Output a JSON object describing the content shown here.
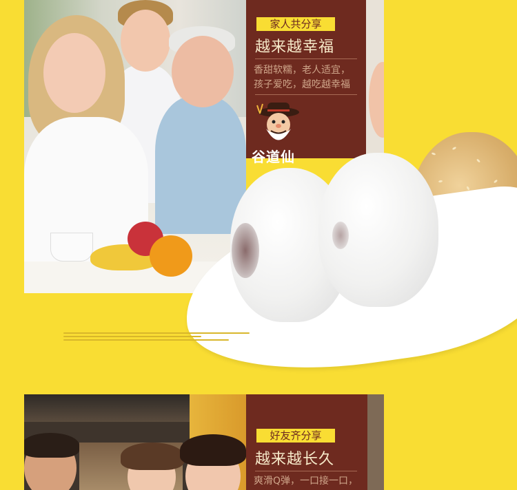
{
  "section1": {
    "tag": "家人共分享",
    "headline": "越来越幸福",
    "body_line1": "香甜软糯，老人适宜，",
    "body_line2": "孩子爱吃，越吃越幸福"
  },
  "brand": {
    "name": "谷道仙",
    "mascot_icon": "old-man-cowboy-hat-icon"
  },
  "section2": {
    "tag": "好友齐分享",
    "headline": "越来越长久",
    "body_line1": "爽滑Q弹，一口接一口，"
  },
  "colors": {
    "background": "#f9dd33",
    "card": "#6e2a1f",
    "tag_bg": "#f9dd33",
    "headline": "#f6e9c9",
    "body_text": "#cfa58a"
  }
}
